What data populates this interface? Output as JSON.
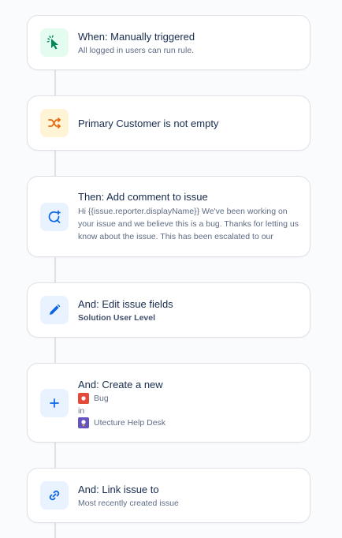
{
  "steps": [
    {
      "title": "When: Manually triggered",
      "subtitle": "All logged in users can run rule.",
      "icon": "cursor-click-icon",
      "tile_color": "#e3fcef",
      "icon_color": "#00875a"
    },
    {
      "title": "Primary Customer is not empty",
      "icon": "shuffle-icon",
      "tile_color": "#fff4d6",
      "icon_color": "#e56910"
    },
    {
      "title": "Then: Add comment to issue",
      "comment": "Hi {{issue.reporter.displayName}} We've been working on your issue and we believe this is a bug. Thanks for letting us know about the issue. This has been escalated to our",
      "icon": "comment-add-icon",
      "tile_color": "#e9f2ff",
      "icon_color": "#0c66e4"
    },
    {
      "title": "And: Edit issue fields",
      "subtitle": "Solution User Level",
      "icon": "pencil-icon",
      "tile_color": "#e9f2ff",
      "icon_color": "#0c66e4"
    },
    {
      "title": "And: Create a new",
      "issue_type": "Bug",
      "in_label": "in",
      "project": "Utecture Help Desk",
      "icon": "plus-icon",
      "tile_color": "#e9f2ff",
      "icon_color": "#0c66e4",
      "bug_color": "#e5493a",
      "project_color": "#6554c0"
    },
    {
      "title": "And: Link issue to",
      "subtitle": "Most recently created issue",
      "icon": "link-icon",
      "tile_color": "#e9f2ff",
      "icon_color": "#0c66e4"
    }
  ]
}
